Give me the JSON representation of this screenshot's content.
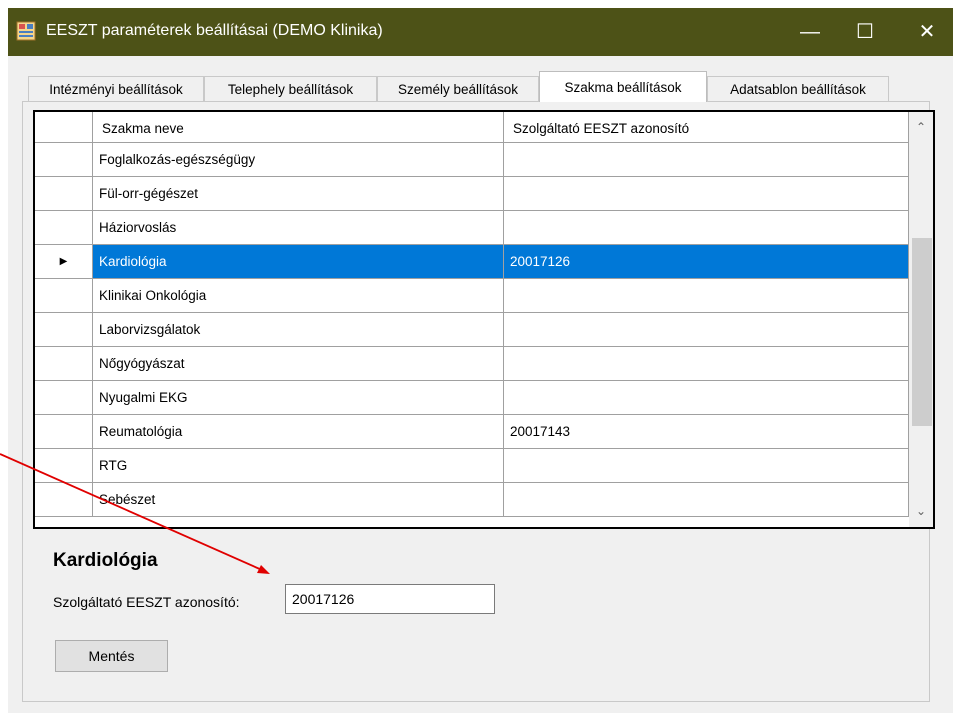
{
  "window": {
    "title": "EESZT paraméterek beállításai (DEMO Klinika)",
    "minimize": "—",
    "maximize": "☐",
    "close": "✕"
  },
  "tabs": [
    {
      "label": "Intézményi beállítások"
    },
    {
      "label": "Telephely beállítások"
    },
    {
      "label": "Személy beállítások"
    },
    {
      "label": "Szakma beállítások",
      "active": true
    },
    {
      "label": "Adatsablon beállítások"
    }
  ],
  "grid": {
    "columns": [
      "Szakma neve",
      "Szolgáltató EESZT azonosító"
    ],
    "rows": [
      {
        "name": "Foglalkozás-egészségügy",
        "id": ""
      },
      {
        "name": "Fül-orr-gégészet",
        "id": ""
      },
      {
        "name": "Háziorvoslás",
        "id": ""
      },
      {
        "name": "Kardiológia",
        "id": "20017126",
        "selected": true
      },
      {
        "name": "Klinikai Onkológia",
        "id": ""
      },
      {
        "name": "Laborvizsgálatok",
        "id": ""
      },
      {
        "name": "Nőgyógyászat",
        "id": ""
      },
      {
        "name": "Nyugalmi EKG",
        "id": ""
      },
      {
        "name": "Reumatológia",
        "id": "20017143"
      },
      {
        "name": "RTG",
        "id": ""
      },
      {
        "name": "Sebészet",
        "id": ""
      }
    ],
    "row_indicator": "▶",
    "scroll_up": "⌃",
    "scroll_down": "⌄"
  },
  "detail": {
    "title": "Kardiológia",
    "field_label": "Szolgáltató EESZT azonosító:",
    "field_value": "20017126",
    "save_label": "Mentés"
  },
  "colors": {
    "titlebar": "#4d5217",
    "selection": "#0078d7",
    "annotation_arrow": "#e00000"
  }
}
